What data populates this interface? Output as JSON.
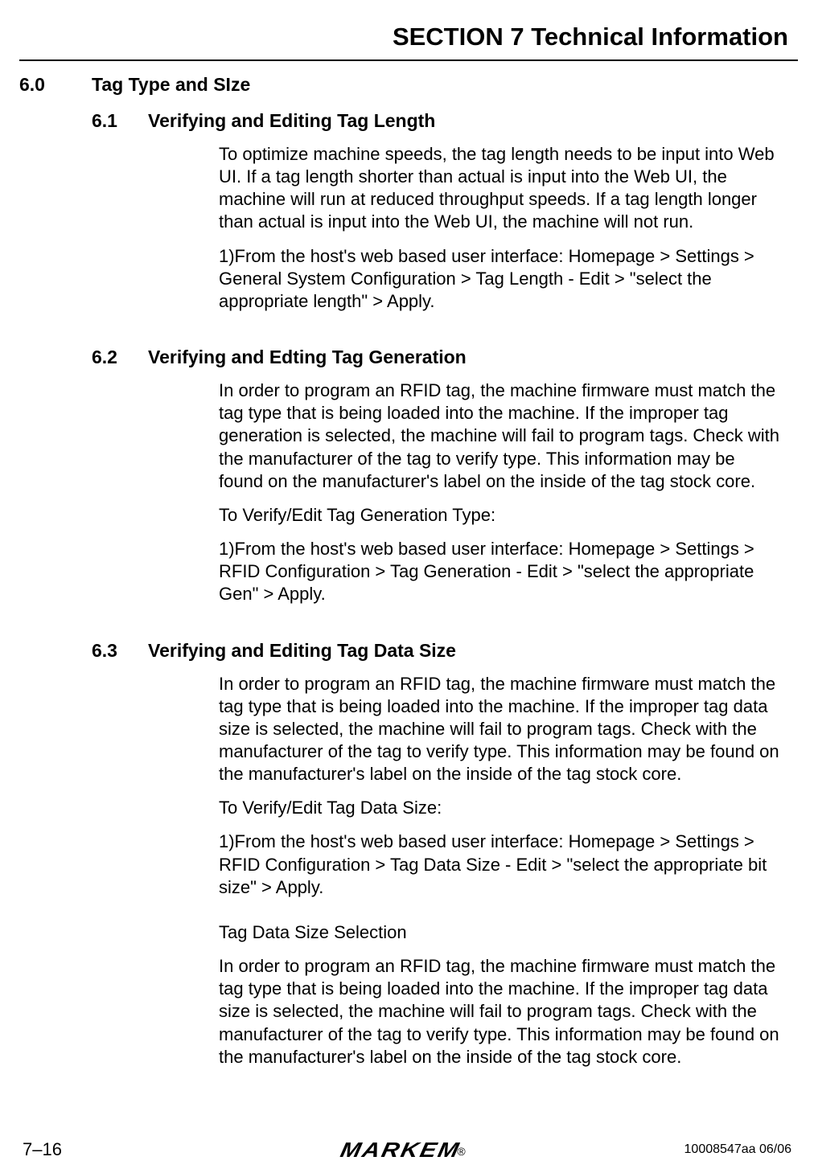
{
  "header": {
    "section_title": "SECTION 7 Technical Information"
  },
  "sections": {
    "s60": {
      "num": "6.0",
      "title": "Tag Type and SIze"
    },
    "s61": {
      "num": "6.1",
      "title": "Verifying and Editing Tag Length",
      "p1": "To optimize machine speeds, the tag length needs to be input into Web UI. If a tag length shorter than actual is input into the Web UI, the machine will run at reduced throughput speeds. If a tag length longer than actual is input into the Web UI, the machine will not run.",
      "p2": "1)From the host's web based user interface: Homepage > Settings > General System Configuration > Tag Length - Edit > \"select the appropriate length\" > Apply."
    },
    "s62": {
      "num": "6.2",
      "title": "Verifying and Edting Tag Generation",
      "p1": "In order to program an RFID tag, the machine firmware must match the tag type that is being loaded into the machine. If the improper tag generation is selected, the machine will fail to program tags. Check with the manufacturer of the tag to verify type. This information may be found on the manufacturer's label on the inside of the tag stock core.",
      "p2": "To Verify/Edit Tag Generation Type:",
      "p3": "1)From the host's web based user interface: Homepage > Settings > RFID Configuration > Tag Generation - Edit > \"select the appropriate Gen\" > Apply."
    },
    "s63": {
      "num": "6.3",
      "title": "Verifying and Editing Tag Data Size",
      "p1": "In order to program an RFID tag, the machine firmware must match the tag type that is being loaded into the machine. If the improper tag data size is selected, the machine will fail to program tags. Check with the manufacturer of the tag to verify type. This information may be found on the manufacturer's label on the inside of the tag stock core.",
      "p2": "To Verify/Edit Tag Data Size:",
      "p3": "1)From the host's web based user interface: Homepage > Settings > RFID Configuration > Tag Data Size - Edit > \"select the appropriate bit size\" > Apply.",
      "p4": "Tag Data Size Selection",
      "p5": "In order to program an RFID tag, the machine firmware must match the tag type that is being loaded into the machine. If the improper tag data size is selected, the machine will fail to program tags. Check with the manufacturer of the tag to verify type. This information may be found on the manufacturer's label on the inside of the tag stock core."
    }
  },
  "footer": {
    "page_number": "7–16",
    "brand": "MARKEM",
    "reg": "®",
    "docref": "10008547aa 06/06"
  }
}
